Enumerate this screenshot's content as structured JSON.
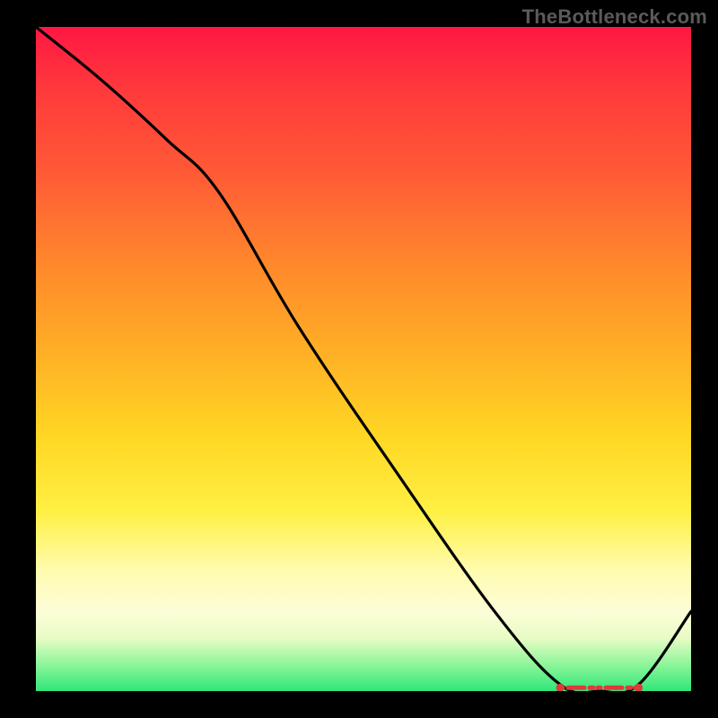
{
  "watermark": "TheBottleneck.com",
  "chart_data": {
    "type": "line",
    "title": "",
    "xlabel": "",
    "ylabel": "",
    "xlim": [
      0,
      100
    ],
    "ylim": [
      0,
      100
    ],
    "series": [
      {
        "name": "curve",
        "x": [
          0,
          10,
          20,
          28,
          40,
          55,
          70,
          80,
          86,
          92,
          100
        ],
        "values": [
          100,
          92,
          83,
          75,
          55,
          33,
          12,
          1,
          0,
          1,
          12
        ]
      }
    ],
    "flat_marker": {
      "x_start": 80,
      "x_end": 92,
      "y": 0.5,
      "color_hex": "#de3a3a"
    },
    "background_gradient_stops": [
      {
        "pct": 0,
        "hex": "#ff1744"
      },
      {
        "pct": 10,
        "hex": "#ff3b3b"
      },
      {
        "pct": 22,
        "hex": "#ff5a36"
      },
      {
        "pct": 38,
        "hex": "#ff8f2a"
      },
      {
        "pct": 50,
        "hex": "#ffb225"
      },
      {
        "pct": 62,
        "hex": "#ffd824"
      },
      {
        "pct": 73,
        "hex": "#fff044"
      },
      {
        "pct": 82,
        "hex": "#fffcb0"
      },
      {
        "pct": 88,
        "hex": "#fcfdd8"
      },
      {
        "pct": 92,
        "hex": "#e8fcc5"
      },
      {
        "pct": 96,
        "hex": "#8ef59a"
      },
      {
        "pct": 100,
        "hex": "#2fe77a"
      }
    ]
  }
}
